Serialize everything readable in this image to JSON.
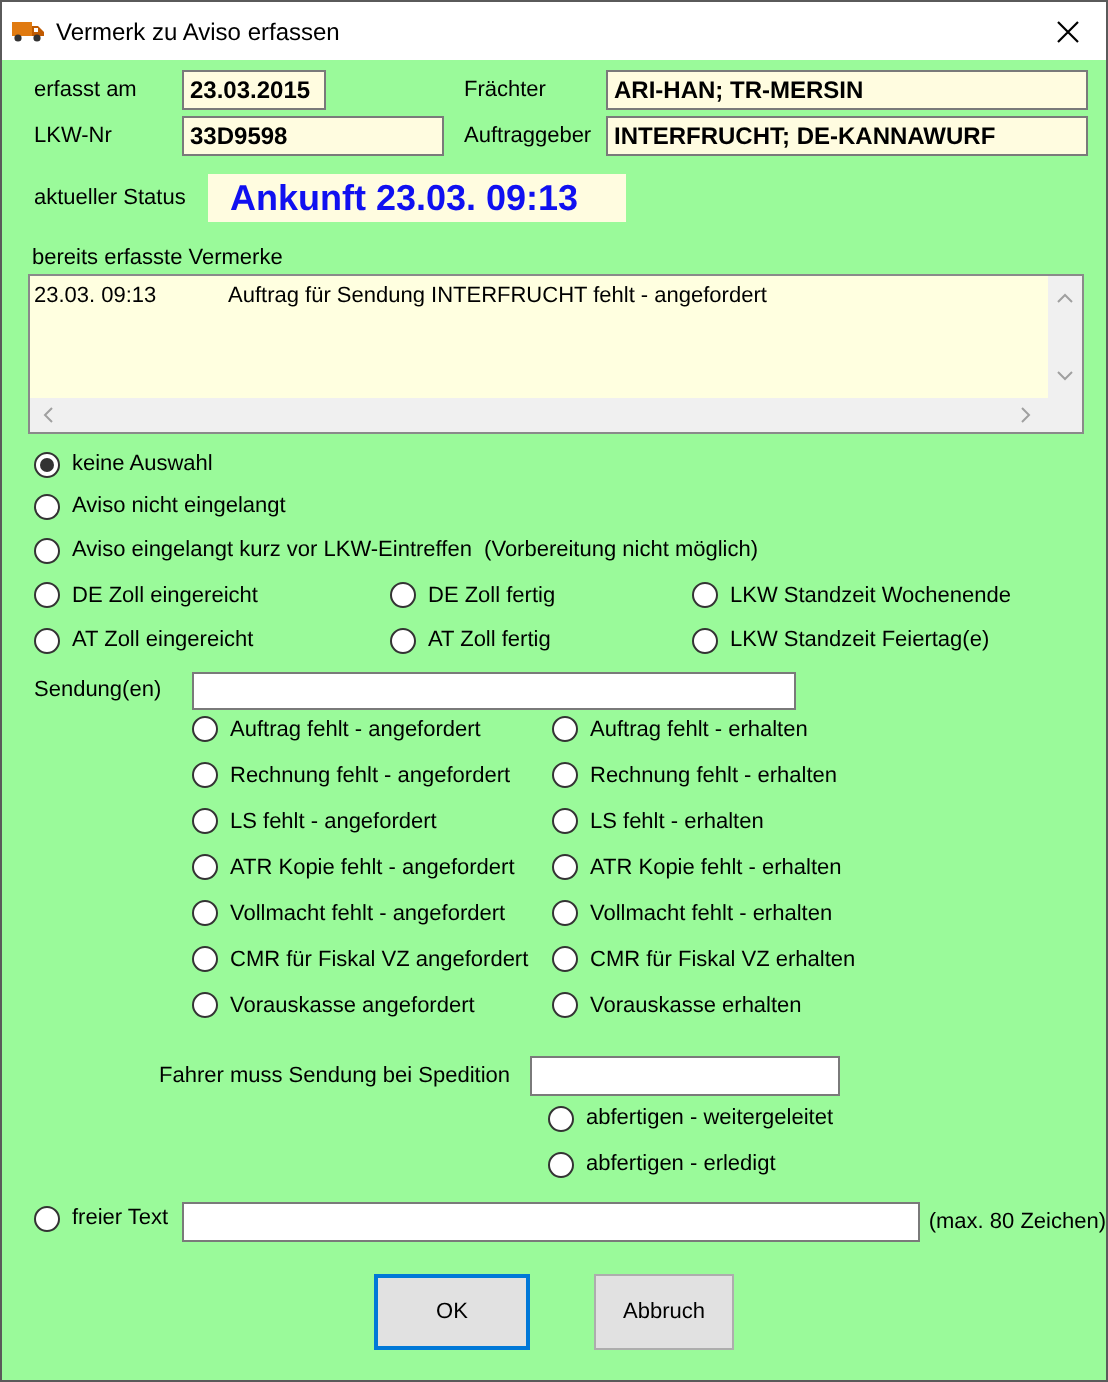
{
  "window": {
    "title": "Vermerk zu Aviso erfassen"
  },
  "header": [
    {
      "label": "erfasst am",
      "value": "23.03.2015"
    },
    {
      "label": "Frächter",
      "value": "ARI-HAN; TR-MERSIN"
    },
    {
      "label": "LKW-Nr",
      "value": "33D9598"
    },
    {
      "label": "Auftraggeber",
      "value": "INTERFRUCHT; DE-KANNAWURF"
    }
  ],
  "status": {
    "label": "aktueller Status",
    "value": "Ankunft 23.03. 09:13"
  },
  "notes": {
    "label": "bereits erfasste Vermerke",
    "rows": [
      {
        "time": "23.03. 09:13",
        "text": "Auftrag für Sendung INTERFRUCHT fehlt - angefordert"
      }
    ]
  },
  "status_rows": [
    {
      "options": [
        {
          "label": "keine Auswahl",
          "selected": true
        }
      ]
    },
    {
      "options": [
        {
          "label": "Aviso nicht eingelangt",
          "selected": false
        }
      ]
    },
    {
      "options": [
        {
          "label": "Aviso eingelangt kurz vor LKW-Eintreffen  (Vorbereitung nicht möglich)",
          "selected": false
        }
      ]
    },
    {
      "options": [
        {
          "label": "DE Zoll eingereicht",
          "selected": false
        },
        {
          "label": "DE Zoll fertig",
          "selected": false
        },
        {
          "label": "LKW Standzeit Wochenende",
          "selected": false
        }
      ]
    },
    {
      "options": [
        {
          "label": "AT Zoll eingereicht",
          "selected": false
        },
        {
          "label": "AT Zoll fertig",
          "selected": false
        },
        {
          "label": "LKW Standzeit Feiertag(e)",
          "selected": false
        }
      ]
    }
  ],
  "shipment": {
    "label": "Sendung(en)"
  },
  "document_rows": [
    {
      "options": [
        {
          "label": "Auftrag fehlt - angefordert",
          "selected": false
        },
        {
          "label": "Auftrag fehlt - erhalten",
          "selected": false
        }
      ]
    },
    {
      "options": [
        {
          "label": "Rechnung fehlt - angefordert",
          "selected": false
        },
        {
          "label": "Rechnung fehlt - erhalten",
          "selected": false
        }
      ]
    },
    {
      "options": [
        {
          "label": "LS fehlt - angefordert",
          "selected": false
        },
        {
          "label": "LS fehlt - erhalten",
          "selected": false
        }
      ]
    },
    {
      "options": [
        {
          "label": "ATR Kopie fehlt - angefordert",
          "selected": false
        },
        {
          "label": "ATR Kopie fehlt - erhalten",
          "selected": false
        }
      ]
    },
    {
      "options": [
        {
          "label": "Vollmacht fehlt - angefordert",
          "selected": false
        },
        {
          "label": "Vollmacht fehlt - erhalten",
          "selected": false
        }
      ]
    },
    {
      "options": [
        {
          "label": "CMR für Fiskal VZ angefordert",
          "selected": false
        },
        {
          "label": "CMR für Fiskal VZ erhalten",
          "selected": false
        }
      ]
    },
    {
      "options": [
        {
          "label": "Vorauskasse angefordert",
          "selected": false
        },
        {
          "label": "Vorauskasse erhalten",
          "selected": false
        }
      ]
    }
  ],
  "forwarding": {
    "label": "Fahrer muss Sendung bei Spedition",
    "options": [
      {
        "label": "abfertigen - weitergeleitet",
        "selected": false
      },
      {
        "label": "abfertigen - erledigt",
        "selected": false
      }
    ]
  },
  "free_text": {
    "label": "freier Text",
    "selected": false,
    "hint": "(max. 80 Zeichen)"
  },
  "buttons": [
    {
      "label": "OK",
      "default": true
    },
    {
      "label": "Abbruch",
      "default": false
    }
  ]
}
